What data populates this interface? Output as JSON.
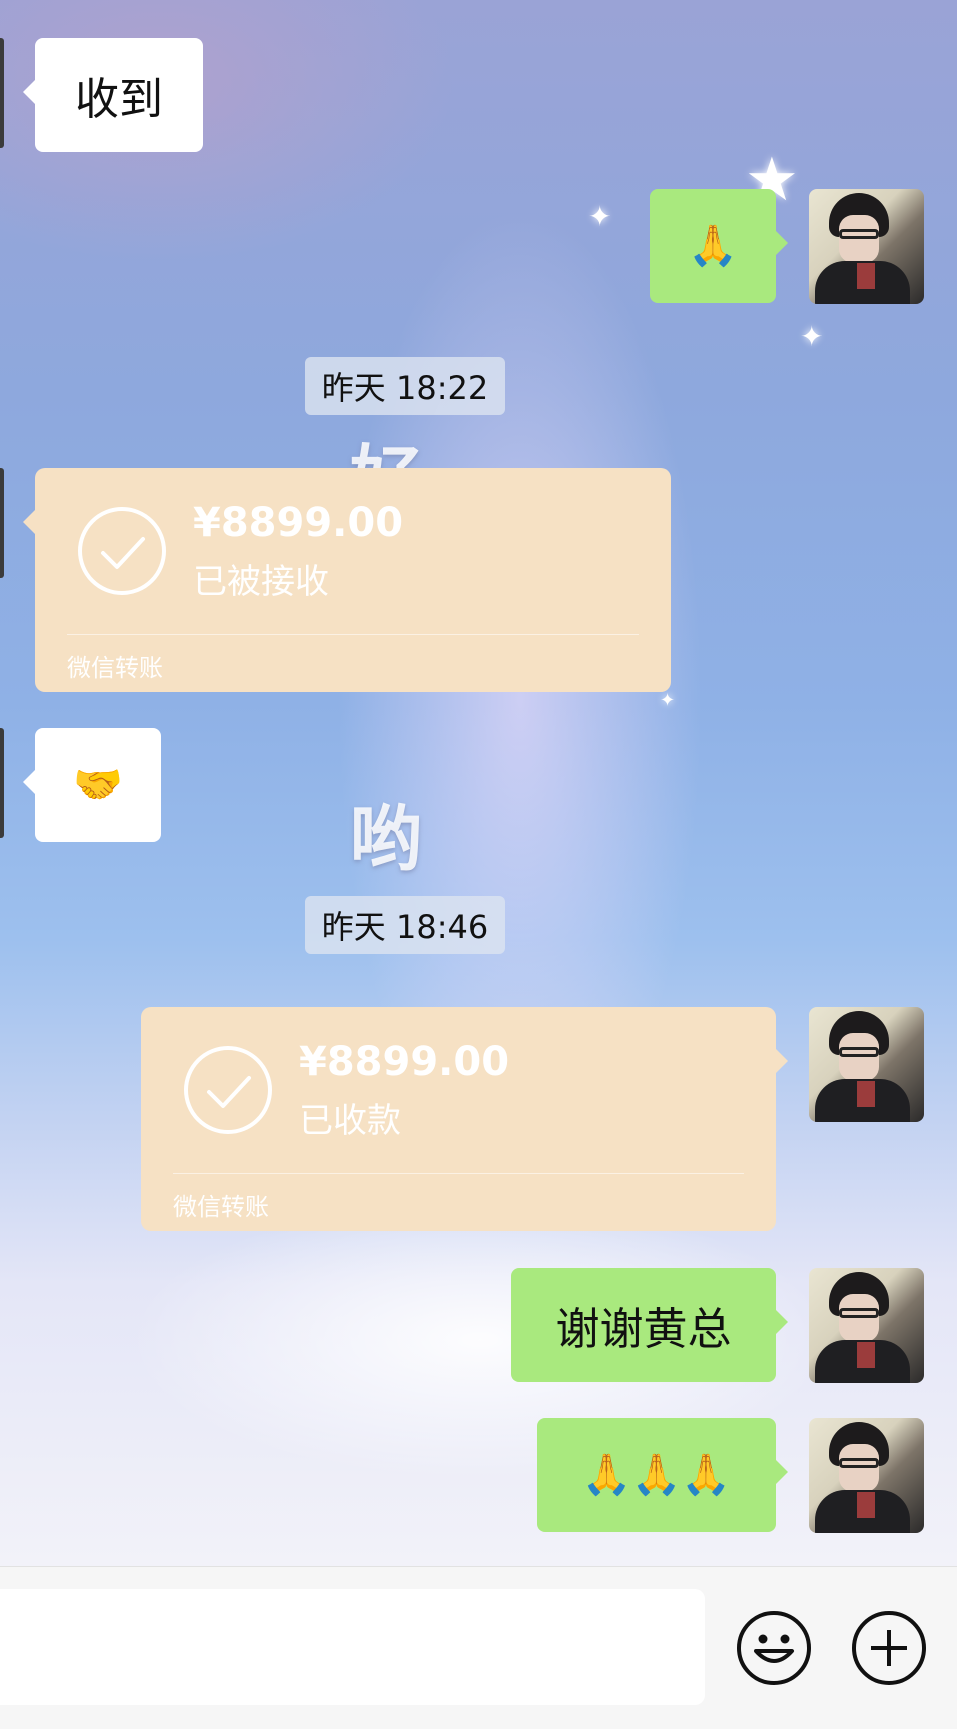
{
  "messages": [
    {
      "side": "incoming",
      "type": "text",
      "text": "收到"
    },
    {
      "side": "outgoing",
      "type": "emoji",
      "emoji": "🙏"
    },
    {
      "type": "time",
      "text": "昨天 18:22"
    },
    {
      "side": "incoming",
      "type": "transfer",
      "amount": "¥8899.00",
      "status": "已被接收",
      "label": "微信转账"
    },
    {
      "side": "incoming",
      "type": "emoji",
      "emoji": "🤝"
    },
    {
      "type": "time",
      "text": "昨天 18:46"
    },
    {
      "side": "outgoing",
      "type": "transfer",
      "amount": "¥8899.00",
      "status": "已收款",
      "label": "微信转账"
    },
    {
      "side": "outgoing",
      "type": "text",
      "text": "谢谢黄总"
    },
    {
      "side": "outgoing",
      "type": "emoji",
      "emoji": "🙏🙏🙏"
    }
  ],
  "background_decor": [
    "好",
    "哟"
  ],
  "input_bar": {
    "emoji_icon": "smiley-face-icon",
    "plus_icon": "plus-circle-icon"
  },
  "colors": {
    "outgoing_bubble": "#a9e97e",
    "incoming_bubble": "#ffffff",
    "transfer_card": "#f6e1c4"
  }
}
